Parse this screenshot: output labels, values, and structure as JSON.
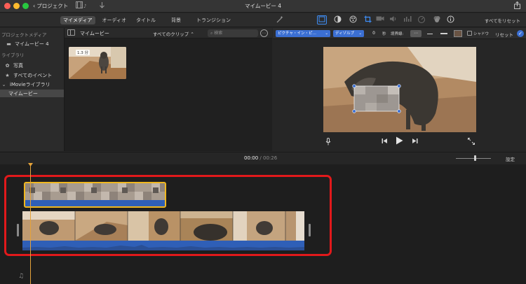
{
  "titlebar": {
    "back_label": "プロジェクト",
    "window_title": "マイムービー 4"
  },
  "media_tabs": [
    {
      "label": "マイメディア",
      "active": true
    },
    {
      "label": "オーディオ",
      "active": false
    },
    {
      "label": "タイトル",
      "active": false
    },
    {
      "label": "背景",
      "active": false
    },
    {
      "label": "トランジション",
      "active": false
    }
  ],
  "toolbar": {
    "reset_all_label": "すべてをリセット"
  },
  "sidebar": {
    "project_media_heading": "プロジェクトメディア",
    "project_item": "マイムービー 4",
    "libraries_heading": "ライブラリ",
    "photos_item": "写真",
    "all_events_item": "すべてのイベント",
    "library_item": "iMovieライブラリ",
    "selected_event": "マイムービー"
  },
  "browser": {
    "title": "マイムービー",
    "filter_label": "すべてのクリップ",
    "search_placeholder": "検索",
    "clip_duration": "1.3 分"
  },
  "adjust_bar": {
    "overlay_mode": "ピクチャ・イン・ピ…",
    "transition_style": "ディゾルブ",
    "duration_value": "0",
    "seconds_label": "秒",
    "border_label": "境界線:",
    "shadow_label": "シャドウ",
    "reset_label": "リセット"
  },
  "timeline_header": {
    "current_time": "00:00",
    "separator": "/",
    "total_time": "00:26",
    "settings_label": "設定"
  },
  "colors": {
    "accent_blue": "#3b6fd3",
    "selection_yellow": "#f0b71f",
    "highlight_red": "#e1191b",
    "playhead": "#e5a33a"
  },
  "icons": {
    "back": "chevron-left-icon",
    "film": "film-music-icon",
    "import": "download-arrow-icon",
    "share": "share-icon",
    "magic_wand": "magic-wand-icon",
    "video_overlay": "video-overlay-icon",
    "color_balance": "color-balance-icon",
    "color_correction": "palette-icon",
    "crop": "crop-icon",
    "stabilization": "camera-icon",
    "volume": "speaker-icon",
    "noise": "equalizer-icon",
    "speed": "speedometer-icon",
    "filters": "filter-circles-icon",
    "info": "info-icon",
    "microphone": "microphone-icon",
    "prev": "skip-back-icon",
    "play": "play-icon",
    "next": "skip-forward-icon",
    "fullscreen": "fullscreen-icon",
    "music": "music-note-icon"
  }
}
